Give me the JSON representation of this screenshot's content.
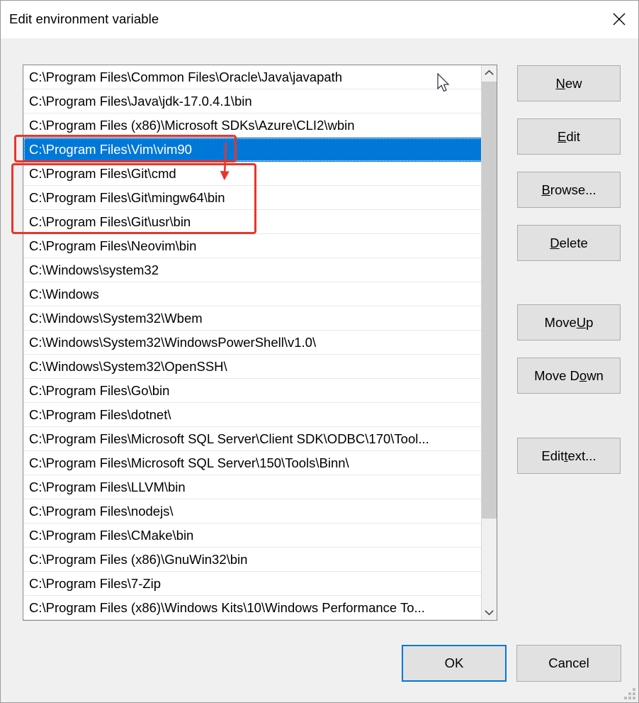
{
  "window": {
    "title": "Edit environment variable",
    "close_icon": "close-icon"
  },
  "list": {
    "items": [
      "C:\\Program Files\\Common Files\\Oracle\\Java\\javapath",
      "C:\\Program Files\\Java\\jdk-17.0.4.1\\bin",
      "C:\\Program Files (x86)\\Microsoft SDKs\\Azure\\CLI2\\wbin",
      "C:\\Program Files\\Vim\\vim90",
      "C:\\Program Files\\Git\\cmd",
      "C:\\Program Files\\Git\\mingw64\\bin",
      "C:\\Program Files\\Git\\usr\\bin",
      "C:\\Program Files\\Neovim\\bin",
      "C:\\Windows\\system32",
      "C:\\Windows",
      "C:\\Windows\\System32\\Wbem",
      "C:\\Windows\\System32\\WindowsPowerShell\\v1.0\\",
      "C:\\Windows\\System32\\OpenSSH\\",
      "C:\\Program Files\\Go\\bin",
      "C:\\Program Files\\dotnet\\",
      "C:\\Program Files\\Microsoft SQL Server\\Client SDK\\ODBC\\170\\Tool...",
      "C:\\Program Files\\Microsoft SQL Server\\150\\Tools\\Binn\\",
      "C:\\Program Files\\LLVM\\bin",
      "C:\\Program Files\\nodejs\\",
      "C:\\Program Files\\CMake\\bin",
      "C:\\Program Files (x86)\\GnuWin32\\bin",
      "C:\\Program Files\\7-Zip",
      "C:\\Program Files (x86)\\Windows Kits\\10\\Windows Performance To..."
    ],
    "selected_index": 3,
    "selected_value": "C:\\Program Files\\Vim\\vim90"
  },
  "scrollbar": {
    "up_icon": "chevron-up-icon",
    "down_icon": "chevron-down-icon"
  },
  "buttons": {
    "new": {
      "accel": "N",
      "rest": "ew"
    },
    "edit": {
      "accel": "E",
      "rest": "dit"
    },
    "browse": {
      "accel": "B",
      "rest": "rowse..."
    },
    "delete": {
      "accel": "D",
      "rest": "elete"
    },
    "move_up": {
      "pre": "Move ",
      "accel": "U",
      "rest": "p"
    },
    "move_down": {
      "pre": "Move D",
      "accel": "o",
      "rest": "wn"
    },
    "edit_text": {
      "pre": "Edit ",
      "accel": "t",
      "rest": "ext..."
    },
    "ok": "OK",
    "cancel": "Cancel"
  },
  "colors": {
    "selection": "#0078d7",
    "annotation": "#e8352a",
    "dialog_bg": "#f0f0f0",
    "button_face": "#e1e1e1"
  }
}
